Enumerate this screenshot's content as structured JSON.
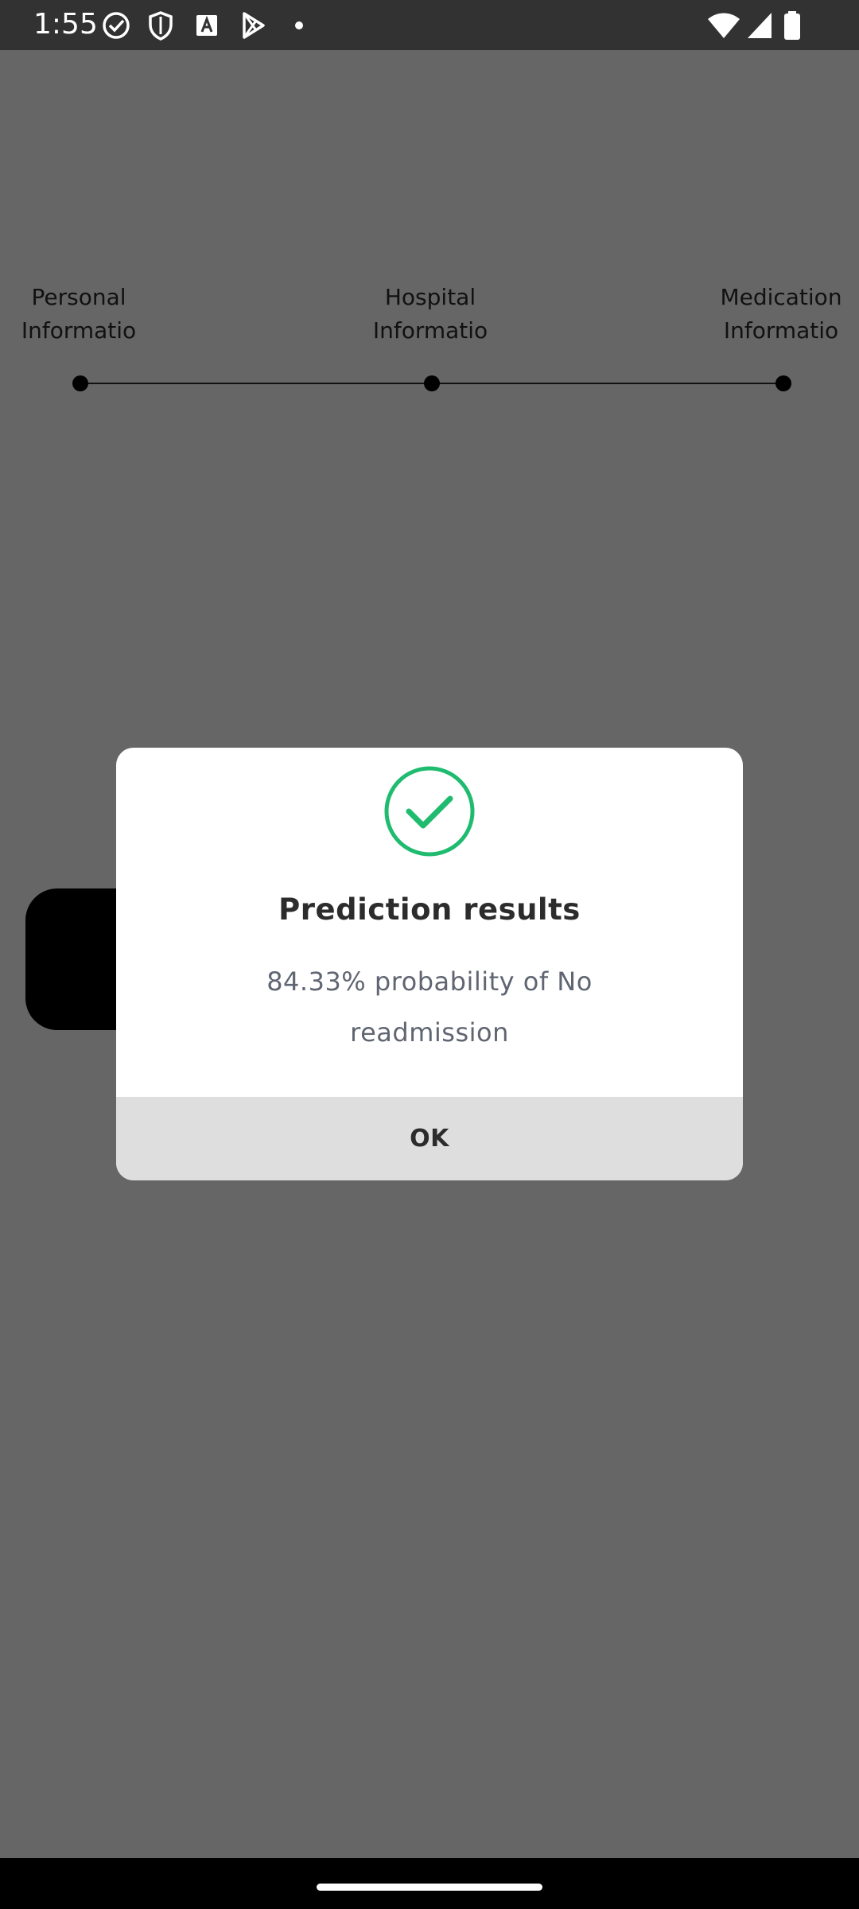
{
  "status_bar": {
    "time": "1:55",
    "icons": [
      "check-circle-icon",
      "shield-icon",
      "font-a-icon",
      "play-store-icon",
      "dot-icon",
      "wifi-icon",
      "signal-icon",
      "battery-icon"
    ]
  },
  "stepper": {
    "steps": [
      {
        "line1": "Personal",
        "line2": "Informatio"
      },
      {
        "line1": "Hospital",
        "line2": "Informatio"
      },
      {
        "line1": "Medication",
        "line2": "Informatio"
      }
    ]
  },
  "dialog": {
    "icon": "success-check-icon",
    "title": "Prediction results",
    "message": "84.33% probability of No readmission",
    "ok_label": "OK"
  },
  "colors": {
    "overlay": "#666666",
    "success": "#1fbb6f",
    "title": "#2c2c2c",
    "message": "#5f6571",
    "footer": "#dedede"
  }
}
